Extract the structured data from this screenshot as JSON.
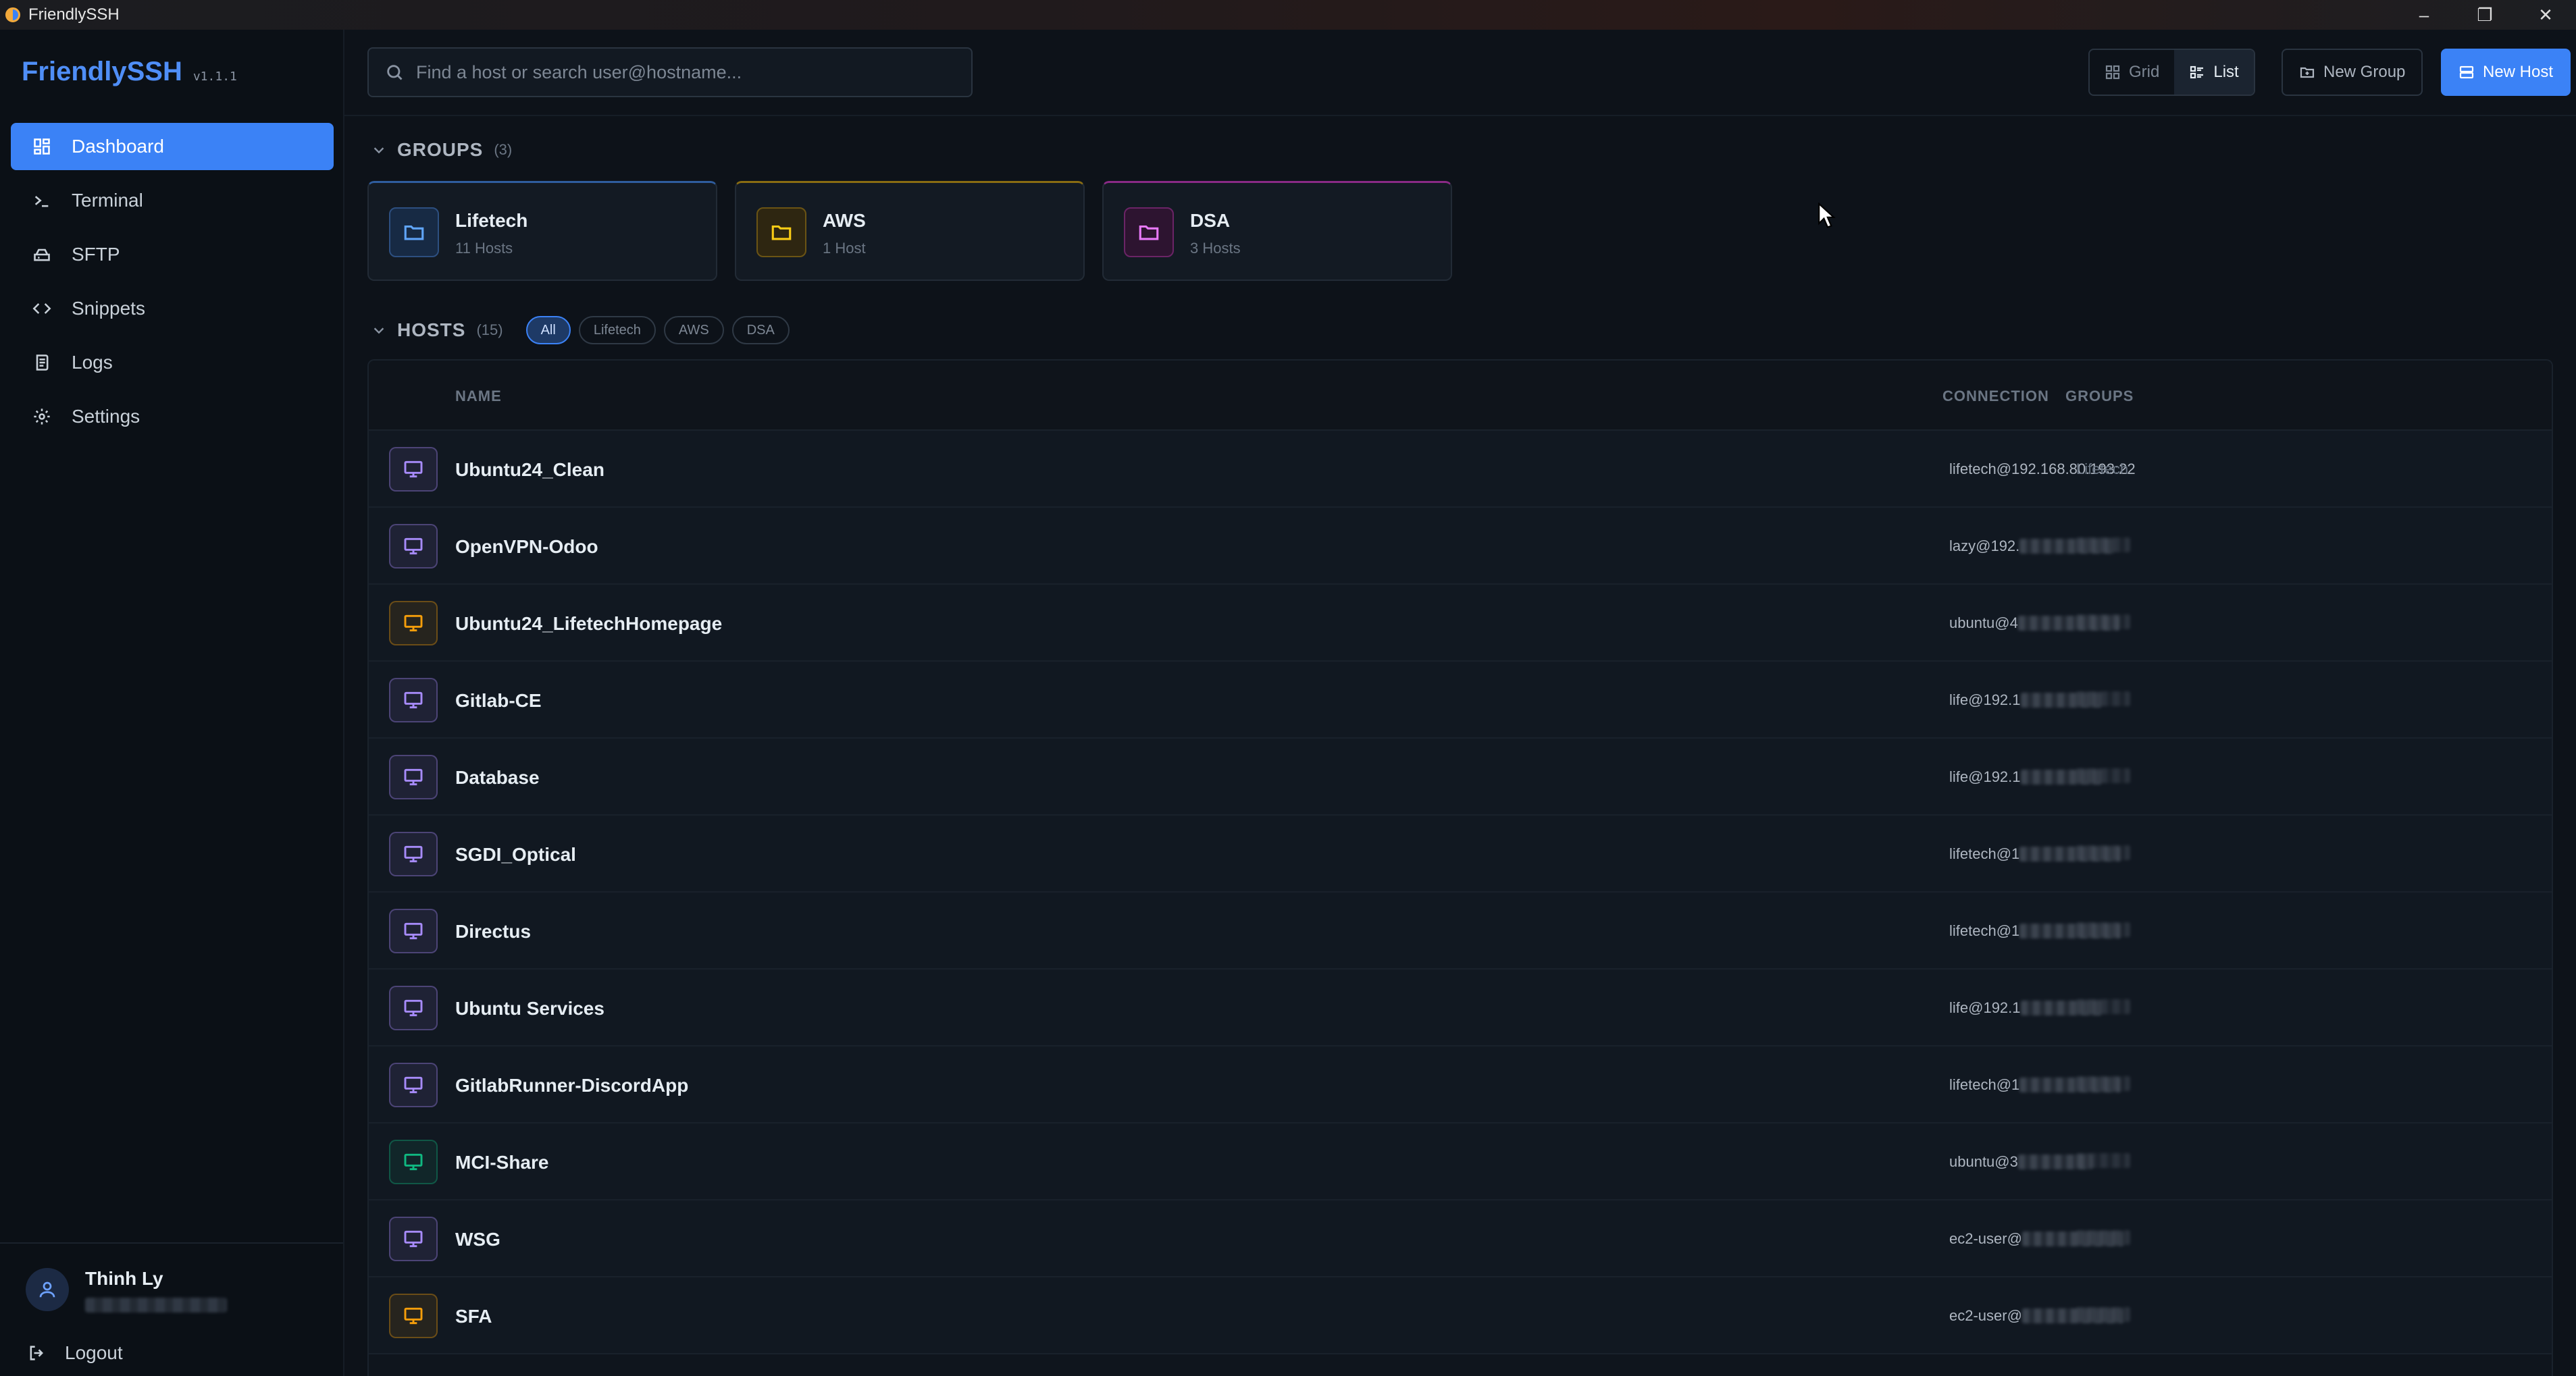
{
  "window": {
    "title": "FriendlySSH"
  },
  "sidebar": {
    "brand": "FriendlySSH",
    "version": "v1.1.1",
    "items": [
      {
        "label": "Dashboard",
        "icon": "grid-icon",
        "active": true
      },
      {
        "label": "Terminal",
        "icon": "terminal-icon"
      },
      {
        "label": "SFTP",
        "icon": "drive-icon"
      },
      {
        "label": "Snippets",
        "icon": "code-icon"
      },
      {
        "label": "Logs",
        "icon": "log-icon"
      },
      {
        "label": "Settings",
        "icon": "gear-icon"
      }
    ],
    "user": {
      "name": "Thinh Ly"
    },
    "logout": "Logout"
  },
  "topbar": {
    "search_placeholder": "Find a host or search user@hostname...",
    "view_grid": "Grid",
    "view_list": "List",
    "new_group": "New Group",
    "new_host": "New Host"
  },
  "groups": {
    "title": "GROUPS",
    "count": "(3)",
    "items": [
      {
        "name": "Lifetech",
        "sub": "11 Hosts",
        "color": "#3b82f6"
      },
      {
        "name": "AWS",
        "sub": "1 Host",
        "color": "#eab308"
      },
      {
        "name": "DSA",
        "sub": "3 Hosts",
        "color": "#d946ef"
      }
    ]
  },
  "hosts": {
    "title": "HOSTS",
    "count": "(15)",
    "filters": [
      "All",
      "Lifetech",
      "AWS",
      "DSA"
    ],
    "columns": {
      "name": "NAME",
      "connection": "CONNECTION",
      "groups": "GROUPS"
    },
    "rows": [
      {
        "name": "Ubuntu24_Clean",
        "conn": "lifetech@192.168.80.193:22",
        "group": "Lifetech",
        "color": "#a78bfa"
      },
      {
        "name": "OpenVPN-Odoo",
        "conn": "lazy@192.",
        "group": "",
        "color": "#a78bfa"
      },
      {
        "name": "Ubuntu24_LifetechHomepage",
        "conn": "ubuntu@4",
        "group": "",
        "color": "#f59e0b"
      },
      {
        "name": "Gitlab-CE",
        "conn": "life@192.1",
        "group": "",
        "color": "#a78bfa"
      },
      {
        "name": "Database",
        "conn": "life@192.1",
        "group": "",
        "color": "#a78bfa"
      },
      {
        "name": "SGDI_Optical",
        "conn": "lifetech@1",
        "group": "",
        "color": "#a78bfa"
      },
      {
        "name": "Directus",
        "conn": "lifetech@1",
        "group": "",
        "color": "#a78bfa"
      },
      {
        "name": "Ubuntu Services",
        "conn": "life@192.1",
        "group": "",
        "color": "#a78bfa"
      },
      {
        "name": "GitlabRunner-DiscordApp",
        "conn": "lifetech@1",
        "group": "",
        "color": "#a78bfa"
      },
      {
        "name": "MCI-Share",
        "conn": "ubuntu@3",
        "group": "",
        "color": "#10b981"
      },
      {
        "name": "WSG",
        "conn": "ec2-user@",
        "group": "",
        "color": "#a78bfa"
      },
      {
        "name": "SFA",
        "conn": "ec2-user@",
        "group": "",
        "color": "#f59e0b"
      }
    ]
  }
}
